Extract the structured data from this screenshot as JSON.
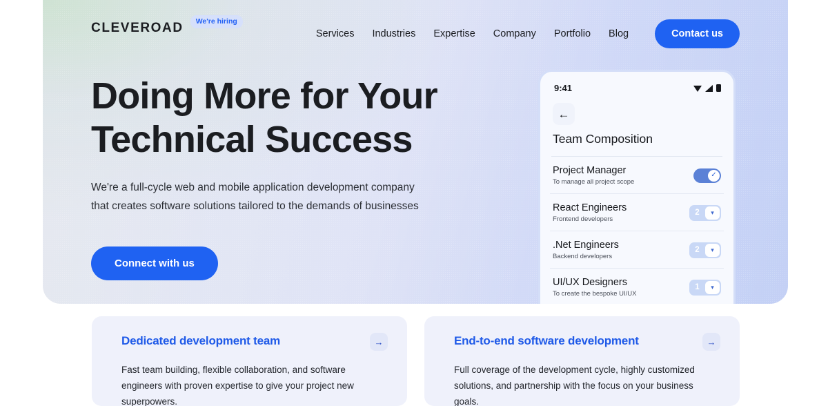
{
  "header": {
    "logo": "CLEVEROAD",
    "hiring_badge": "We're hiring",
    "nav": [
      {
        "label": "Services"
      },
      {
        "label": "Industries"
      },
      {
        "label": "Expertise"
      },
      {
        "label": "Company"
      },
      {
        "label": "Portfolio"
      },
      {
        "label": "Blog"
      }
    ],
    "contact_button": "Contact us"
  },
  "hero": {
    "headline_line1": "Doing More for Your",
    "headline_line2": "Technical Success",
    "subhead_line1": "We're a full-cycle web and mobile application development company",
    "subhead_line2": "that creates software solutions tailored to the demands of businesses",
    "cta_button": "Connect with us"
  },
  "phone": {
    "status_time": "9:41",
    "status_icons": [
      "wifi-icon",
      "signal-icon",
      "battery-icon"
    ],
    "back_icon": "←",
    "screen_title": "Team Composition",
    "team": [
      {
        "role": "Project Manager",
        "desc": "To manage all project scope",
        "control": "toggle",
        "toggle_on": true,
        "check": "✓"
      },
      {
        "role": "React Engineers",
        "desc": "Frontend developers",
        "control": "stepper",
        "count": "2",
        "chevron": "▾"
      },
      {
        "role": ".Net Engineers",
        "desc": "Backend developers",
        "control": "stepper",
        "count": "2",
        "chevron": "▾"
      },
      {
        "role": "UI/UX Designers",
        "desc": "To create the bespoke UI/UX",
        "control": "stepper",
        "count": "1",
        "chevron": "▾"
      }
    ]
  },
  "cards": [
    {
      "title": "Dedicated development team",
      "body": "Fast team building, flexible collaboration, and software engineers with proven expertise to give your project new superpowers.",
      "arrow": "→"
    },
    {
      "title": "End-to-end software development",
      "body": "Full coverage of the development cycle, highly customized solutions, and partnership with the focus on your business goals.",
      "arrow": "→"
    }
  ],
  "colors": {
    "accent_blue": "#1f62f2",
    "link_blue": "#1f5ae8",
    "hero_gradient_left": "#dfe8e0",
    "hero_gradient_right": "#c3d0f5",
    "card_bg": "#eff1fb"
  }
}
